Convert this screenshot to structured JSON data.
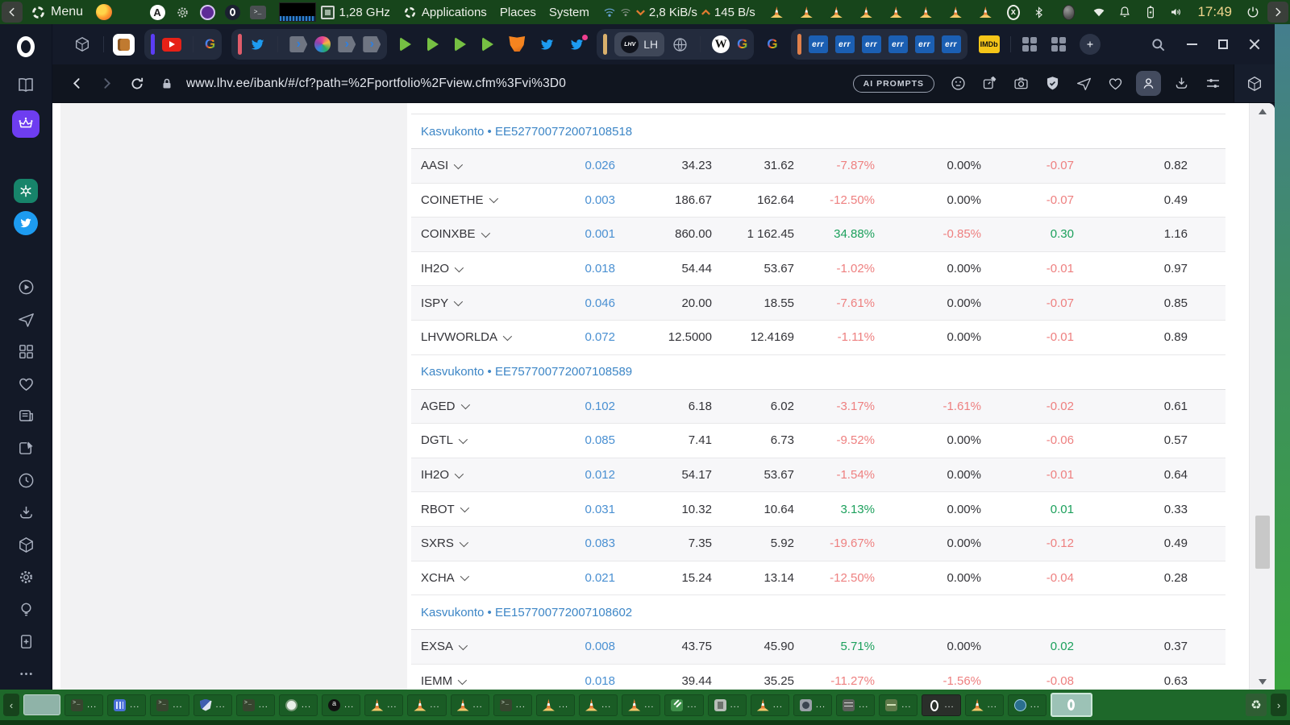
{
  "system_bar": {
    "menu_label": "Menu",
    "menus": [
      "Applications",
      "Places",
      "System"
    ],
    "cpu_freq": "1,28 GHz",
    "net_down": "2,8 KiB/s",
    "net_up": "145 B/s",
    "clock": "17:49",
    "vlc_cone_count": 8
  },
  "browser": {
    "url": "www.lhv.ee/ibank/#/cf?path=%2Fportfolio%2Fview.cfm%3Fvi%3D0",
    "ai_prompts_label": "AI PROMPTS"
  },
  "tabs": {
    "active_label": "LH",
    "lhv_logo": "LHV",
    "wiki": "W",
    "google": "G",
    "err": "err",
    "err_count": 6,
    "imdb": "IMDb"
  },
  "icons": {
    "chevron_left": "‹",
    "chevron_right": "›",
    "recycle": "♻",
    "terminal_prompt": ">_",
    "circle_x": "x",
    "launcher_a": "A"
  },
  "portfolio": {
    "groups": [
      {
        "account": "Kasvukonto • EE527700772007108518",
        "rows": [
          {
            "ticker": "AASI",
            "qty": "0.026",
            "avg": "34.23",
            "price": "31.62",
            "chg_pct": "-7.87%",
            "day_pct": "0.00%",
            "chg_eur": "-0.07",
            "value": "0.82"
          },
          {
            "ticker": "COINETHE",
            "qty": "0.003",
            "avg": "186.67",
            "price": "162.64",
            "chg_pct": "-12.50%",
            "day_pct": "0.00%",
            "chg_eur": "-0.07",
            "value": "0.49"
          },
          {
            "ticker": "COINXBE",
            "qty": "0.001",
            "avg": "860.00",
            "price": "1 162.45",
            "chg_pct": "34.88%",
            "day_pct": "-0.85%",
            "chg_eur": "0.30",
            "value": "1.16"
          },
          {
            "ticker": "IH2O",
            "qty": "0.018",
            "avg": "54.44",
            "price": "53.67",
            "chg_pct": "-1.02%",
            "day_pct": "0.00%",
            "chg_eur": "-0.01",
            "value": "0.97"
          },
          {
            "ticker": "ISPY",
            "qty": "0.046",
            "avg": "20.00",
            "price": "18.55",
            "chg_pct": "-7.61%",
            "day_pct": "0.00%",
            "chg_eur": "-0.07",
            "value": "0.85"
          },
          {
            "ticker": "LHVWORLDA",
            "qty": "0.072",
            "avg": "12.5000",
            "price": "12.4169",
            "chg_pct": "-1.11%",
            "day_pct": "0.00%",
            "chg_eur": "-0.01",
            "value": "0.89"
          }
        ]
      },
      {
        "account": "Kasvukonto • EE757700772007108589",
        "rows": [
          {
            "ticker": "AGED",
            "qty": "0.102",
            "avg": "6.18",
            "price": "6.02",
            "chg_pct": "-3.17%",
            "day_pct": "-1.61%",
            "chg_eur": "-0.02",
            "value": "0.61"
          },
          {
            "ticker": "DGTL",
            "qty": "0.085",
            "avg": "7.41",
            "price": "6.73",
            "chg_pct": "-9.52%",
            "day_pct": "0.00%",
            "chg_eur": "-0.06",
            "value": "0.57"
          },
          {
            "ticker": "IH2O",
            "qty": "0.012",
            "avg": "54.17",
            "price": "53.67",
            "chg_pct": "-1.54%",
            "day_pct": "0.00%",
            "chg_eur": "-0.01",
            "value": "0.64"
          },
          {
            "ticker": "RBOT",
            "qty": "0.031",
            "avg": "10.32",
            "price": "10.64",
            "chg_pct": "3.13%",
            "day_pct": "0.00%",
            "chg_eur": "0.01",
            "value": "0.33"
          },
          {
            "ticker": "SXRS",
            "qty": "0.083",
            "avg": "7.35",
            "price": "5.92",
            "chg_pct": "-19.67%",
            "day_pct": "0.00%",
            "chg_eur": "-0.12",
            "value": "0.49"
          },
          {
            "ticker": "XCHA",
            "qty": "0.021",
            "avg": "15.24",
            "price": "13.14",
            "chg_pct": "-12.50%",
            "day_pct": "0.00%",
            "chg_eur": "-0.04",
            "value": "0.28"
          }
        ]
      },
      {
        "account": "Kasvukonto • EE157700772007108602",
        "rows": [
          {
            "ticker": "EXSA",
            "qty": "0.008",
            "avg": "43.75",
            "price": "45.90",
            "chg_pct": "5.71%",
            "day_pct": "0.00%",
            "chg_eur": "0.02",
            "value": "0.37"
          },
          {
            "ticker": "IEMM",
            "qty": "0.018",
            "avg": "39.44",
            "price": "35.25",
            "chg_pct": "-11.27%",
            "day_pct": "-1.56%",
            "chg_eur": "-0.08",
            "value": "0.63"
          }
        ]
      }
    ]
  },
  "taskbar": {
    "ellipsis": "...",
    "buttons": [
      "terminal",
      "app-grid",
      "terminal",
      "shield",
      "terminal",
      "disc",
      "audio",
      "vlc-cone",
      "vlc-cone",
      "vlc-cone",
      "terminal",
      "vlc-cone",
      "vlc-cone",
      "vlc-cone",
      "text-editor",
      "file-manager",
      "vlc-cone",
      "photo",
      "cabinet",
      "package",
      "opera",
      "vlc-cone",
      "earth"
    ]
  },
  "colors": {
    "negative": "#ee8080",
    "positive": "#1ca05c",
    "link_blue": "#4a90d2",
    "account_blue": "#3d86c6",
    "systembar_green": "#17451b",
    "taskbar_green": "#1e682a"
  }
}
